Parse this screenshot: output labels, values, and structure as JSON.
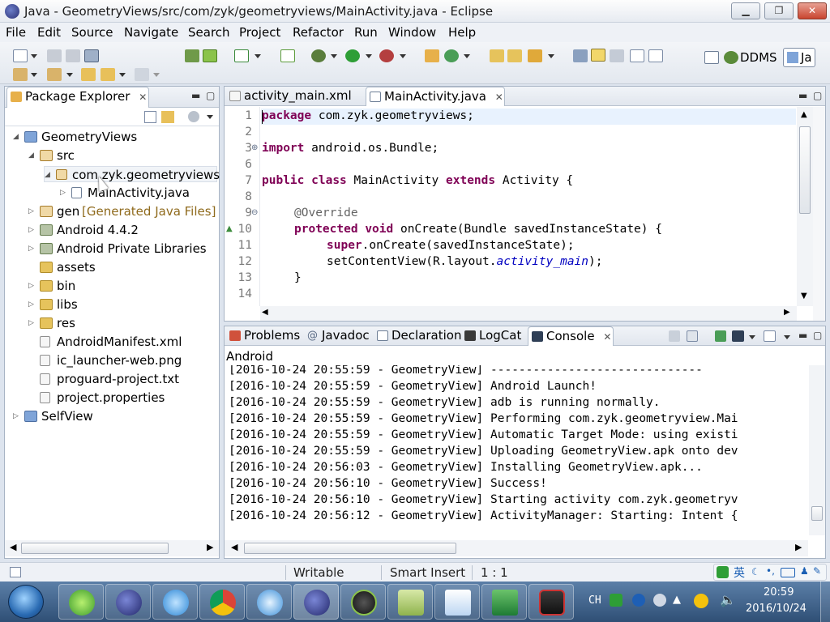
{
  "window": {
    "title": "Java - GeometryViews/src/com/zyk/geometryviews/MainActivity.java - Eclipse",
    "min_glyph": "▁",
    "max_glyph": "❐",
    "close_glyph": "✕"
  },
  "menu": [
    "File",
    "Edit",
    "Source",
    "Navigate",
    "Search",
    "Project",
    "Refactor",
    "Run",
    "Window",
    "Help"
  ],
  "perspectives": {
    "ddms": "DDMS",
    "java": "Ja"
  },
  "package_explorer": {
    "title": "Package Explorer",
    "close": "✕",
    "items": [
      {
        "label": "GeometryViews",
        "icon": "project-icon"
      },
      {
        "label": "src",
        "icon": "source-folder-icon"
      },
      {
        "label": "com.zyk.geometryviews",
        "icon": "package-icon"
      },
      {
        "label": "MainActivity.java",
        "icon": "java-file-icon"
      },
      {
        "label": "gen",
        "extra": "[Generated Java Files]",
        "icon": "source-folder-icon"
      },
      {
        "label": "Android 4.4.2",
        "icon": "library-icon"
      },
      {
        "label": "Android Private Libraries",
        "icon": "library-icon"
      },
      {
        "label": "assets",
        "icon": "folder-icon"
      },
      {
        "label": "bin",
        "icon": "folder-icon"
      },
      {
        "label": "libs",
        "icon": "folder-icon"
      },
      {
        "label": "res",
        "icon": "folder-icon"
      },
      {
        "label": "AndroidManifest.xml",
        "icon": "xml-file-icon"
      },
      {
        "label": "ic_launcher-web.png",
        "icon": "image-file-icon"
      },
      {
        "label": "proguard-project.txt",
        "icon": "text-file-icon"
      },
      {
        "label": "project.properties",
        "icon": "text-file-icon"
      },
      {
        "label": "SelfView",
        "icon": "project-icon"
      }
    ]
  },
  "editor": {
    "tabs": [
      {
        "label": "activity_main.xml"
      },
      {
        "label": "MainActivity.java",
        "close": "✕"
      }
    ],
    "line_numbers": [
      "1",
      "2",
      "3",
      "6",
      "7",
      "8",
      "9",
      "10",
      "11",
      "12",
      "13",
      "14"
    ],
    "code": {
      "l1_kw": "package",
      "l1_rest": " com.zyk.geometryviews;",
      "l3_kw": "import",
      "l3_rest": " android.os.Bundle;",
      "l7_kw1": "public",
      "l7_kw2": "class",
      "l7_name": " MainActivity ",
      "l7_kw3": "extends",
      "l7_rest": " Activity {",
      "l9_ann": "@Override",
      "l10_kw1": "protected",
      "l10_kw2": "void",
      "l10_rest": " onCreate(Bundle savedInstanceState) {",
      "l11_kw": "super",
      "l11_rest": ".onCreate(savedInstanceState);",
      "l12_pre": "setContentView(R.layout.",
      "l12_it": "activity_main",
      "l12_post": ");",
      "l13": "}"
    }
  },
  "bottom": {
    "tabs": [
      {
        "label": "Problems"
      },
      {
        "label": "Javadoc"
      },
      {
        "label": "Declaration"
      },
      {
        "label": "LogCat"
      },
      {
        "label": "Console",
        "close": "✕"
      }
    ],
    "console_label": "Android",
    "lines": [
      "[2016-10-24 20:55:59 - GeometryView] ------------------------------",
      "[2016-10-24 20:55:59 - GeometryView] Android Launch!",
      "[2016-10-24 20:55:59 - GeometryView] adb is running normally.",
      "[2016-10-24 20:55:59 - GeometryView] Performing com.zyk.geometryview.Mai",
      "[2016-10-24 20:55:59 - GeometryView] Automatic Target Mode: using existi",
      "[2016-10-24 20:55:59 - GeometryView] Uploading GeometryView.apk onto dev",
      "[2016-10-24 20:56:03 - GeometryView] Installing GeometryView.apk...",
      "[2016-10-24 20:56:10 - GeometryView] Success!",
      "[2016-10-24 20:56:10 - GeometryView] Starting activity com.zyk.geometryv",
      "[2016-10-24 20:56:12 - GeometryView] ActivityManager: Starting: Intent {"
    ]
  },
  "status": {
    "writable": "Writable",
    "insert_mode": "Smart Insert",
    "position": "1 : 1"
  },
  "taskbar": {
    "ime_label": "英",
    "lang": "CH",
    "time": "20:59",
    "date": "2016/10/24"
  }
}
